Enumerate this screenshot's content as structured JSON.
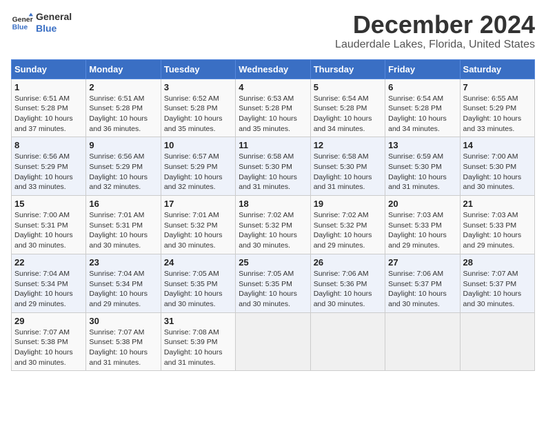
{
  "header": {
    "logo_line1": "General",
    "logo_line2": "Blue",
    "month_title": "December 2024",
    "location": "Lauderdale Lakes, Florida, United States"
  },
  "days_of_week": [
    "Sunday",
    "Monday",
    "Tuesday",
    "Wednesday",
    "Thursday",
    "Friday",
    "Saturday"
  ],
  "weeks": [
    [
      {
        "day": "1",
        "sunrise": "6:51 AM",
        "sunset": "5:28 PM",
        "daylight": "10 hours and 37 minutes."
      },
      {
        "day": "2",
        "sunrise": "6:51 AM",
        "sunset": "5:28 PM",
        "daylight": "10 hours and 36 minutes."
      },
      {
        "day": "3",
        "sunrise": "6:52 AM",
        "sunset": "5:28 PM",
        "daylight": "10 hours and 35 minutes."
      },
      {
        "day": "4",
        "sunrise": "6:53 AM",
        "sunset": "5:28 PM",
        "daylight": "10 hours and 35 minutes."
      },
      {
        "day": "5",
        "sunrise": "6:54 AM",
        "sunset": "5:28 PM",
        "daylight": "10 hours and 34 minutes."
      },
      {
        "day": "6",
        "sunrise": "6:54 AM",
        "sunset": "5:28 PM",
        "daylight": "10 hours and 34 minutes."
      },
      {
        "day": "7",
        "sunrise": "6:55 AM",
        "sunset": "5:29 PM",
        "daylight": "10 hours and 33 minutes."
      }
    ],
    [
      {
        "day": "8",
        "sunrise": "6:56 AM",
        "sunset": "5:29 PM",
        "daylight": "10 hours and 33 minutes."
      },
      {
        "day": "9",
        "sunrise": "6:56 AM",
        "sunset": "5:29 PM",
        "daylight": "10 hours and 32 minutes."
      },
      {
        "day": "10",
        "sunrise": "6:57 AM",
        "sunset": "5:29 PM",
        "daylight": "10 hours and 32 minutes."
      },
      {
        "day": "11",
        "sunrise": "6:58 AM",
        "sunset": "5:30 PM",
        "daylight": "10 hours and 31 minutes."
      },
      {
        "day": "12",
        "sunrise": "6:58 AM",
        "sunset": "5:30 PM",
        "daylight": "10 hours and 31 minutes."
      },
      {
        "day": "13",
        "sunrise": "6:59 AM",
        "sunset": "5:30 PM",
        "daylight": "10 hours and 31 minutes."
      },
      {
        "day": "14",
        "sunrise": "7:00 AM",
        "sunset": "5:30 PM",
        "daylight": "10 hours and 30 minutes."
      }
    ],
    [
      {
        "day": "15",
        "sunrise": "7:00 AM",
        "sunset": "5:31 PM",
        "daylight": "10 hours and 30 minutes."
      },
      {
        "day": "16",
        "sunrise": "7:01 AM",
        "sunset": "5:31 PM",
        "daylight": "10 hours and 30 minutes."
      },
      {
        "day": "17",
        "sunrise": "7:01 AM",
        "sunset": "5:32 PM",
        "daylight": "10 hours and 30 minutes."
      },
      {
        "day": "18",
        "sunrise": "7:02 AM",
        "sunset": "5:32 PM",
        "daylight": "10 hours and 30 minutes."
      },
      {
        "day": "19",
        "sunrise": "7:02 AM",
        "sunset": "5:32 PM",
        "daylight": "10 hours and 29 minutes."
      },
      {
        "day": "20",
        "sunrise": "7:03 AM",
        "sunset": "5:33 PM",
        "daylight": "10 hours and 29 minutes."
      },
      {
        "day": "21",
        "sunrise": "7:03 AM",
        "sunset": "5:33 PM",
        "daylight": "10 hours and 29 minutes."
      }
    ],
    [
      {
        "day": "22",
        "sunrise": "7:04 AM",
        "sunset": "5:34 PM",
        "daylight": "10 hours and 29 minutes."
      },
      {
        "day": "23",
        "sunrise": "7:04 AM",
        "sunset": "5:34 PM",
        "daylight": "10 hours and 29 minutes."
      },
      {
        "day": "24",
        "sunrise": "7:05 AM",
        "sunset": "5:35 PM",
        "daylight": "10 hours and 30 minutes."
      },
      {
        "day": "25",
        "sunrise": "7:05 AM",
        "sunset": "5:35 PM",
        "daylight": "10 hours and 30 minutes."
      },
      {
        "day": "26",
        "sunrise": "7:06 AM",
        "sunset": "5:36 PM",
        "daylight": "10 hours and 30 minutes."
      },
      {
        "day": "27",
        "sunrise": "7:06 AM",
        "sunset": "5:37 PM",
        "daylight": "10 hours and 30 minutes."
      },
      {
        "day": "28",
        "sunrise": "7:07 AM",
        "sunset": "5:37 PM",
        "daylight": "10 hours and 30 minutes."
      }
    ],
    [
      {
        "day": "29",
        "sunrise": "7:07 AM",
        "sunset": "5:38 PM",
        "daylight": "10 hours and 30 minutes."
      },
      {
        "day": "30",
        "sunrise": "7:07 AM",
        "sunset": "5:38 PM",
        "daylight": "10 hours and 31 minutes."
      },
      {
        "day": "31",
        "sunrise": "7:08 AM",
        "sunset": "5:39 PM",
        "daylight": "10 hours and 31 minutes."
      },
      null,
      null,
      null,
      null
    ]
  ]
}
